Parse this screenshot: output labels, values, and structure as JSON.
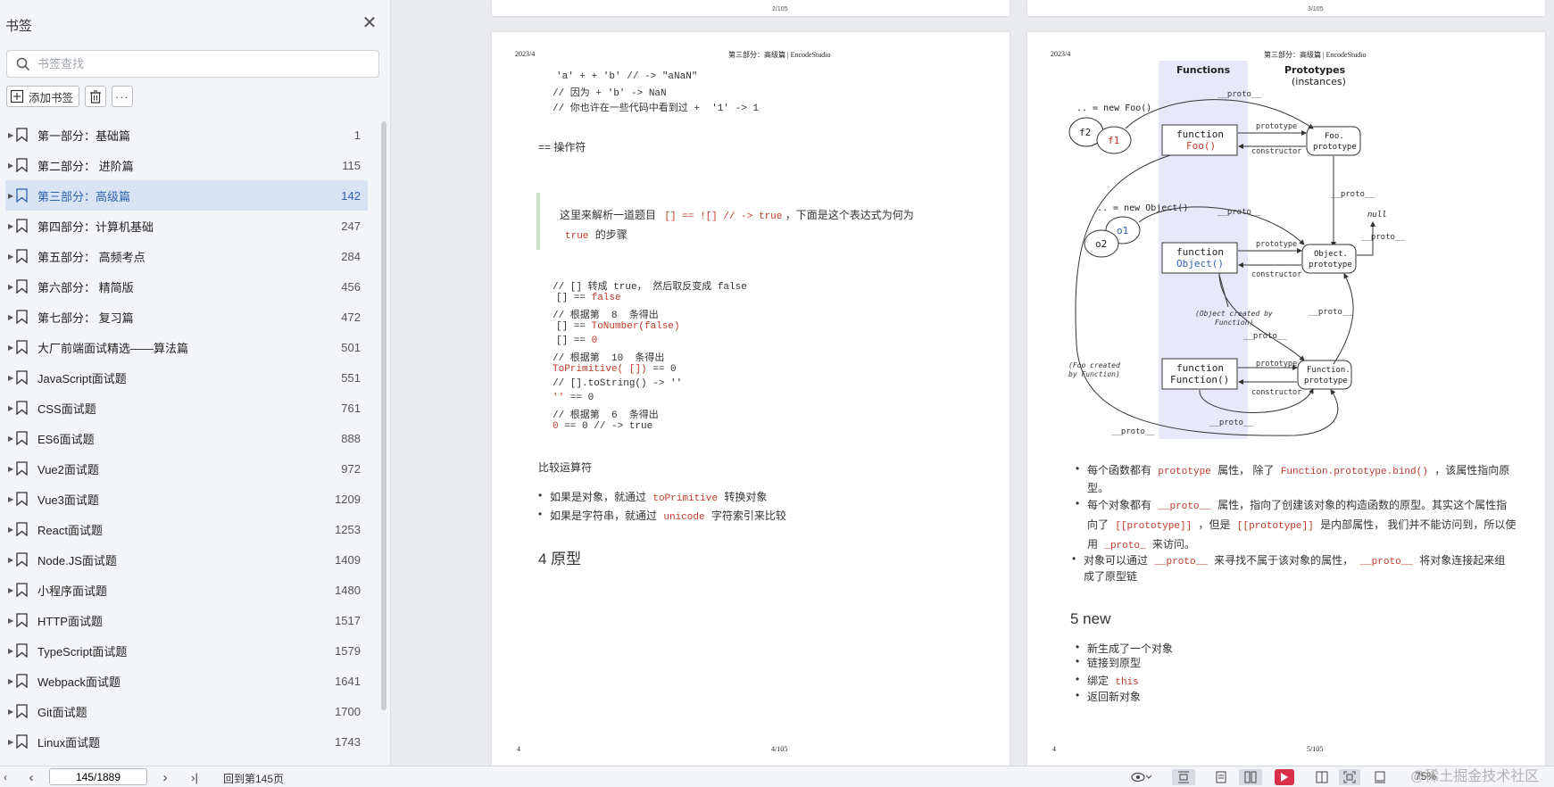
{
  "sidebar": {
    "title": "书签",
    "search_placeholder": "书签查找",
    "add_bookmark": "添加书签",
    "bookmarks": [
      {
        "label": "第一部分：基础篇",
        "page": "1"
      },
      {
        "label": "第二部分： 进阶篇",
        "page": "115"
      },
      {
        "label": "第三部分：高级篇",
        "page": "142"
      },
      {
        "label": "第四部分：计算机基础",
        "page": "247"
      },
      {
        "label": "第五部分： 高频考点",
        "page": "284"
      },
      {
        "label": "第六部分： 精简版",
        "page": "456"
      },
      {
        "label": "第七部分： 复习篇",
        "page": "472"
      },
      {
        "label": "大厂前端面试精选——算法篇",
        "page": "501"
      },
      {
        "label": "JavaScript面试题",
        "page": "551"
      },
      {
        "label": "CSS面试题",
        "page": "761"
      },
      {
        "label": "ES6面试题",
        "page": "888"
      },
      {
        "label": "Vue2面试题",
        "page": "972"
      },
      {
        "label": "Vue3面试题",
        "page": "1209"
      },
      {
        "label": "React面试题",
        "page": "1253"
      },
      {
        "label": "Node.JS面试题",
        "page": "1409"
      },
      {
        "label": "小程序面试题",
        "page": "1480"
      },
      {
        "label": "HTTP面试题",
        "page": "1517"
      },
      {
        "label": "TypeScript面试题",
        "page": "1579"
      },
      {
        "label": "Webpack面试题",
        "page": "1641"
      },
      {
        "label": "Git面试题",
        "page": "1700"
      },
      {
        "label": "Linux面试题",
        "page": "1743"
      }
    ],
    "active_index": 2
  },
  "prev_pages": {
    "left_num": "2/105",
    "right_num": "3/105"
  },
  "left_page": {
    "header_date": "2023/4",
    "header_title": "第三部分：高级篇 | EncodeStudio",
    "code1": [
      "'a' + + 'b' // -> \"aNaN\"",
      "// 因为 + 'b' -> NaN",
      "// 你也许在一些代码中看到过 +  '1' -> 1"
    ],
    "operator_heading": "== 操作符",
    "quote_pre": "这里来解析一道题目",
    "quote_code": "[] == ![] // -> true",
    "quote_post": "，下面是这个表达式为何为",
    "quote_true": "true",
    "quote_end": "的步骤",
    "code2": [
      {
        "a": "// [] 转成 true， 然后取反变成 false",
        "b": ""
      },
      {
        "a": "[] == ",
        "b": "false"
      },
      {
        "a": "// 根据第  8  条得出",
        "b": ""
      },
      {
        "a": "[] == ",
        "b": "ToNumber(false)"
      },
      {
        "a": "[] == ",
        "b": "0"
      },
      {
        "a": "// 根据第  10  条得出",
        "b": ""
      },
      {
        "a": "",
        "b": "ToPrimitive( [])",
        "c": " == 0"
      },
      {
        "a": "// [].toString() -> ''",
        "b": ""
      },
      {
        "a": "",
        "b": "''",
        "c": " == 0"
      },
      {
        "a": "// 根据第  6  条得出",
        "b": ""
      },
      {
        "a": "",
        "b": "0",
        "c": " == 0 // -> true"
      }
    ],
    "compare_heading": "比较运算符",
    "bullets": [
      {
        "pre": "如果是对象，就通过",
        "code": "toPrimitive",
        "post": "转换对象"
      },
      {
        "pre": "如果是字符串，就通过",
        "code": "unicode",
        "post": "字符索引来比较"
      }
    ],
    "section_title": "4 原型",
    "footer_left": "4",
    "footer_center": "4/105"
  },
  "right_page": {
    "header_date": "2023/4",
    "header_title": "第三部分：高级篇 | EncodeStudio",
    "diagram": {
      "col1": "Functions",
      "col2": "Prototypes",
      "col2b": "(instances)",
      "new_foo": ".. = new Foo()",
      "new_obj": ".. = new Object()",
      "f2": "f2",
      "f1": "f1",
      "o1": "o1",
      "o2": "o2",
      "fn_foo_a": "function",
      "fn_foo_b": "Foo()",
      "fn_obj_a": "function",
      "fn_obj_b": "Object()",
      "fn_fn_a": "function",
      "fn_fn_b": "Function()",
      "foo_proto": "Foo.",
      "foo_proto2": "prototype",
      "obj_proto": "Object.",
      "obj_proto2": "prototype",
      "fn_proto": "Function.",
      "fn_proto2": "prototype",
      "proto": "__proto__",
      "prototype": "prototype",
      "constructor": "constructor",
      "null": "null",
      "obj_created": "(Object created by",
      "obj_created2": "Function)",
      "foo_created": "(Foo created",
      "foo_created2": "by Function)"
    },
    "bullets": [
      {
        "pre": "每个函数都有",
        "code": "prototype",
        "mid": "属性， 除了",
        "code2": "Function.prototype.bind()",
        "post": "，该属性指向原",
        "line2": "型。"
      },
      {
        "pre": "每个对象都有",
        "code": "__proto__",
        "mid": "属性，指向了创建该对象的构造函数的原型。其实这个属性指",
        "line2a": "向了",
        "code2": "[[prototype]]",
        "line2b": "，但是",
        "code3": "[[prototype]]",
        "line2c": "是内部属性， 我们并不能访问到，所以使",
        "line3a": "用",
        "code4": "_proto_",
        "line3b": "来访问。"
      },
      {
        "pre": "对象可以通过",
        "code": "__proto__",
        "mid": "来寻找不属于该对象的属性，",
        "code2": "__proto__",
        "post": "将对象连接起来组",
        "line2": "成了原型链"
      }
    ],
    "section_title": "5 new",
    "new_steps": [
      "新生成了一个对象",
      "链接到原型"
    ],
    "bind_pre": "绑定",
    "bind_code": "this",
    "return_step": "返回新对象",
    "footer_left": "4",
    "footer_center": "5/105"
  },
  "bottom_bar": {
    "page_value": "145/1889",
    "back_link": "回到第145页",
    "zoom": "75%"
  },
  "watermark": "@稀土掘金技术社区"
}
